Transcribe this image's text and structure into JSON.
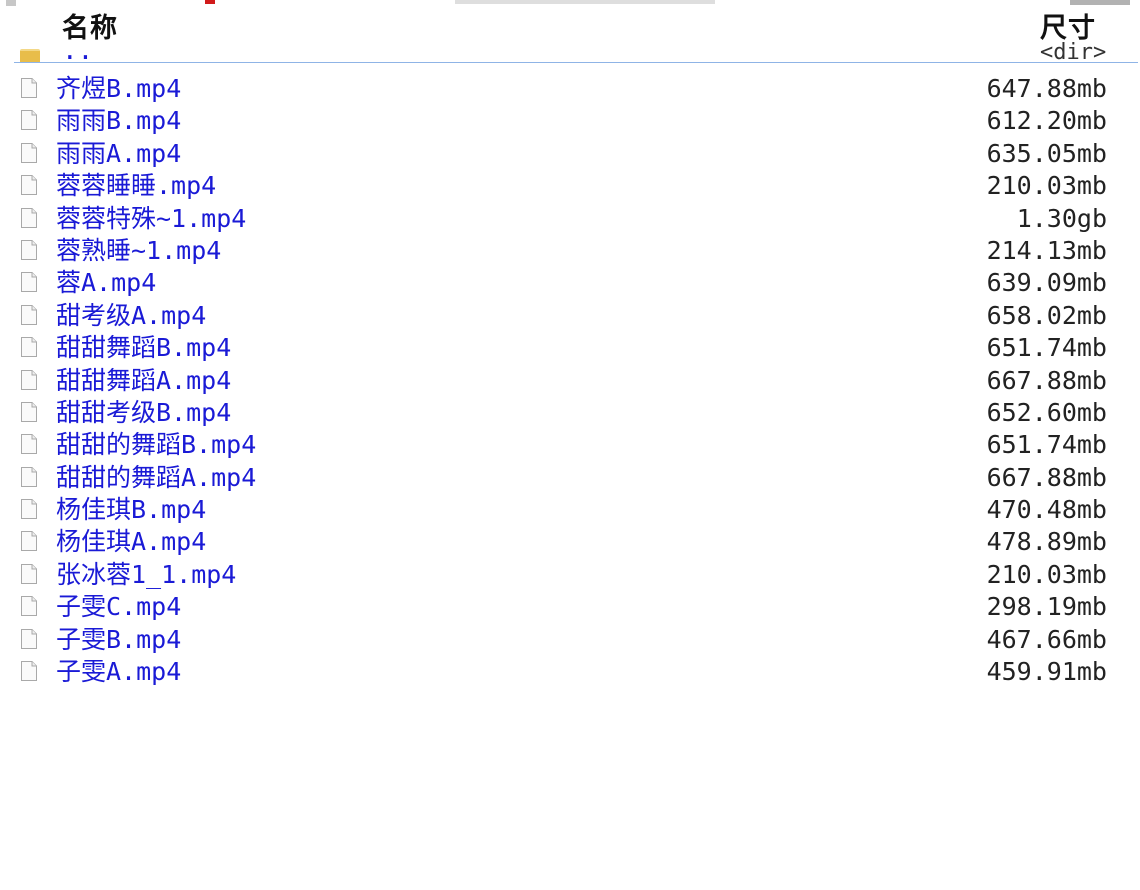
{
  "header": {
    "name_label": "名称",
    "size_label": "尺寸"
  },
  "parent": {
    "name": "..",
    "size": "<dir>",
    "icon": "folder-icon"
  },
  "files": [
    {
      "name": "齐煜B.mp4",
      "size": "647.88mb"
    },
    {
      "name": "雨雨B.mp4",
      "size": "612.20mb"
    },
    {
      "name": "雨雨A.mp4",
      "size": "635.05mb"
    },
    {
      "name": "蓉蓉睡睡.mp4",
      "size": "210.03mb"
    },
    {
      "name": "蓉蓉特殊~1.mp4",
      "size": "1.30gb"
    },
    {
      "name": "蓉熟睡~1.mp4",
      "size": "214.13mb"
    },
    {
      "name": "蓉A.mp4",
      "size": "639.09mb"
    },
    {
      "name": "甜考级A.mp4",
      "size": "658.02mb"
    },
    {
      "name": "甜甜舞蹈B.mp4",
      "size": "651.74mb"
    },
    {
      "name": "甜甜舞蹈A.mp4",
      "size": "667.88mb"
    },
    {
      "name": "甜甜考级B.mp4",
      "size": "652.60mb"
    },
    {
      "name": "甜甜的舞蹈B.mp4",
      "size": "651.74mb"
    },
    {
      "name": "甜甜的舞蹈A.mp4",
      "size": "667.88mb"
    },
    {
      "name": "杨佳琪B.mp4",
      "size": "470.48mb"
    },
    {
      "name": "杨佳琪A.mp4",
      "size": "478.89mb"
    },
    {
      "name": "张冰蓉1_1.mp4",
      "size": "210.03mb"
    },
    {
      "name": "子雯C.mp4",
      "size": "298.19mb"
    },
    {
      "name": "子雯B.mp4",
      "size": "467.66mb"
    },
    {
      "name": "子雯A.mp4",
      "size": "459.91mb"
    }
  ],
  "colors": {
    "link": "#1a1ad6",
    "size_text": "#222222",
    "header_line": "#8fb4e6",
    "folder": "#e8bd4a"
  }
}
